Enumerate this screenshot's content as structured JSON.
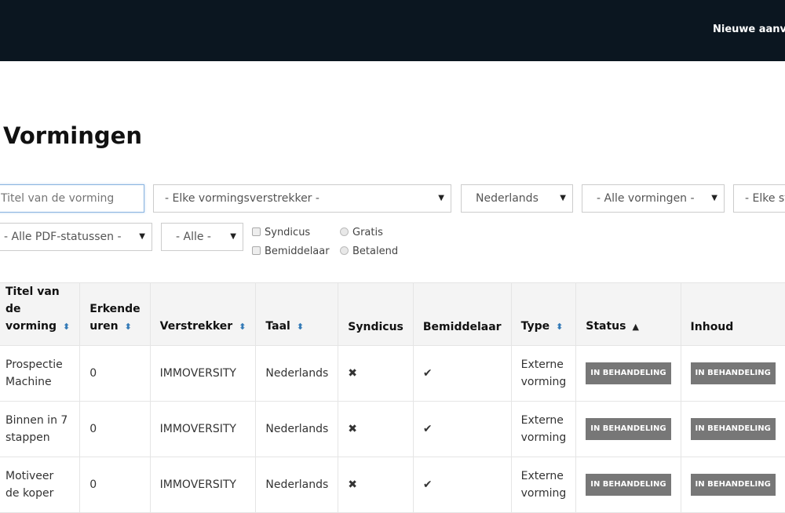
{
  "topnav": {
    "item": "Nieuwe aanvraag"
  },
  "page_title": "Vormingen",
  "filters": {
    "title_placeholder": "Titel van de vorming",
    "provider": "- Elke vormingsverstrekker -",
    "language": "Nederlands",
    "trainings": "- Alle vormingen -",
    "status": "- Elke status -",
    "pdf_status": "- Alle PDF-statussen -",
    "all": "- Alle -",
    "syndicus": "Syndicus",
    "bemiddelaar": "Bemiddelaar",
    "gratis": "Gratis",
    "betalend": "Betalend"
  },
  "table": {
    "headers": [
      "Titel van de vorming",
      "Erkende uren",
      "Verstrekker",
      "Taal",
      "Syndicus",
      "Bemiddelaar",
      "Type",
      "Status",
      "Inhoud"
    ],
    "rows": [
      {
        "title": "Prospectie Machine",
        "hours": "0",
        "provider": "IMMOVERSITY",
        "lang": "Nederlands",
        "syndicus": "✖",
        "bemiddelaar": "✔",
        "type": "Externe vorming",
        "status": "IN BEHANDELING",
        "content": "IN BEHANDELING"
      },
      {
        "title": "Binnen in 7 stappen",
        "hours": "0",
        "provider": "IMMOVERSITY",
        "lang": "Nederlands",
        "syndicus": "✖",
        "bemiddelaar": "✔",
        "type": "Externe vorming",
        "status": "IN BEHANDELING",
        "content": "IN BEHANDELING"
      },
      {
        "title": "Motiveer de koper",
        "hours": "0",
        "provider": "IMMOVERSITY",
        "lang": "Nederlands",
        "syndicus": "✖",
        "bemiddelaar": "✔",
        "type": "Externe vorming",
        "status": "IN BEHANDELING",
        "content": "IN BEHANDELING"
      }
    ]
  }
}
